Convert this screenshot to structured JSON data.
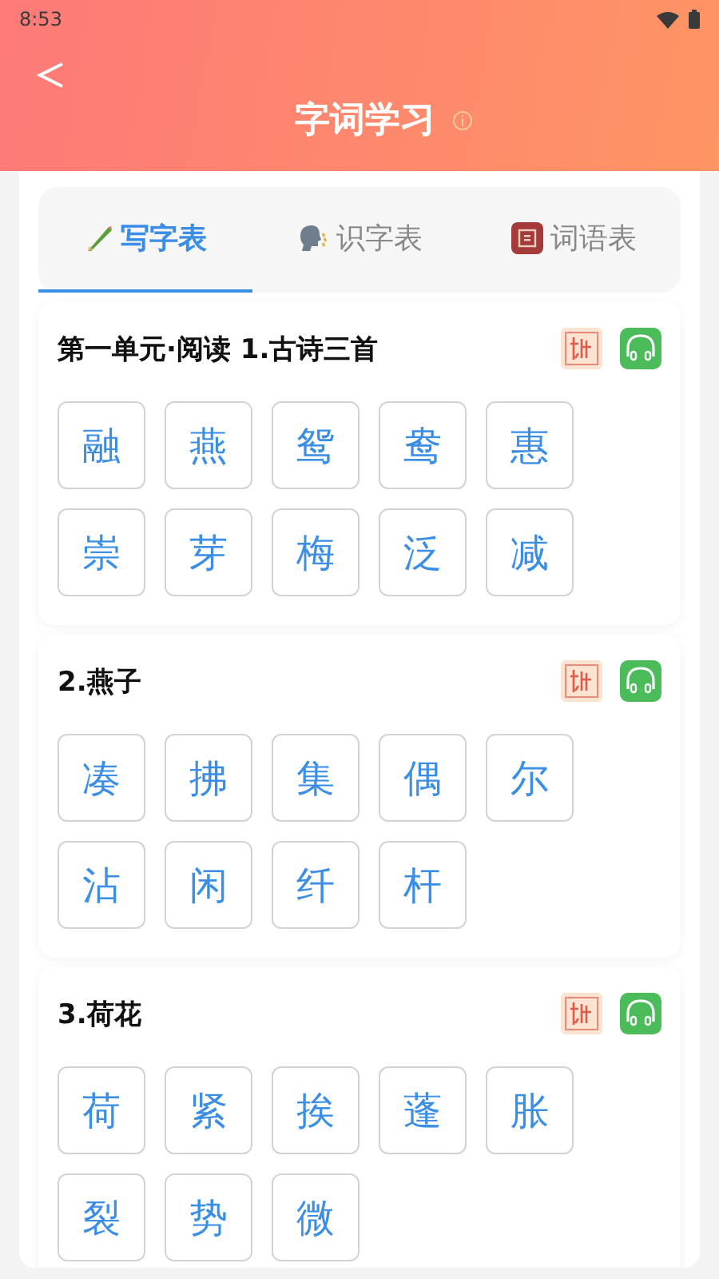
{
  "status_bar": {
    "time": "8:53"
  },
  "header": {
    "title": "字词学习"
  },
  "tabs": [
    {
      "label": "写字表",
      "kind": "pencil",
      "selected": true
    },
    {
      "label": "识字表",
      "kind": "speak",
      "selected": false
    },
    {
      "label": "词语表",
      "kind": "words",
      "selected": false
    }
  ],
  "sections": [
    {
      "title": "第一单元·阅读 1.古诗三首",
      "characters": [
        "融",
        "燕",
        "鸳",
        "鸯",
        "惠",
        "崇",
        "芽",
        "梅",
        "泛",
        "减"
      ]
    },
    {
      "title": "2.燕子",
      "characters": [
        "凑",
        "拂",
        "集",
        "偶",
        "尔",
        "沾",
        "闲",
        "纤",
        "杆"
      ]
    },
    {
      "title": "3.荷花",
      "characters": [
        "荷",
        "紧",
        "挨",
        "蓬",
        "胀",
        "裂",
        "势",
        "微"
      ]
    }
  ]
}
